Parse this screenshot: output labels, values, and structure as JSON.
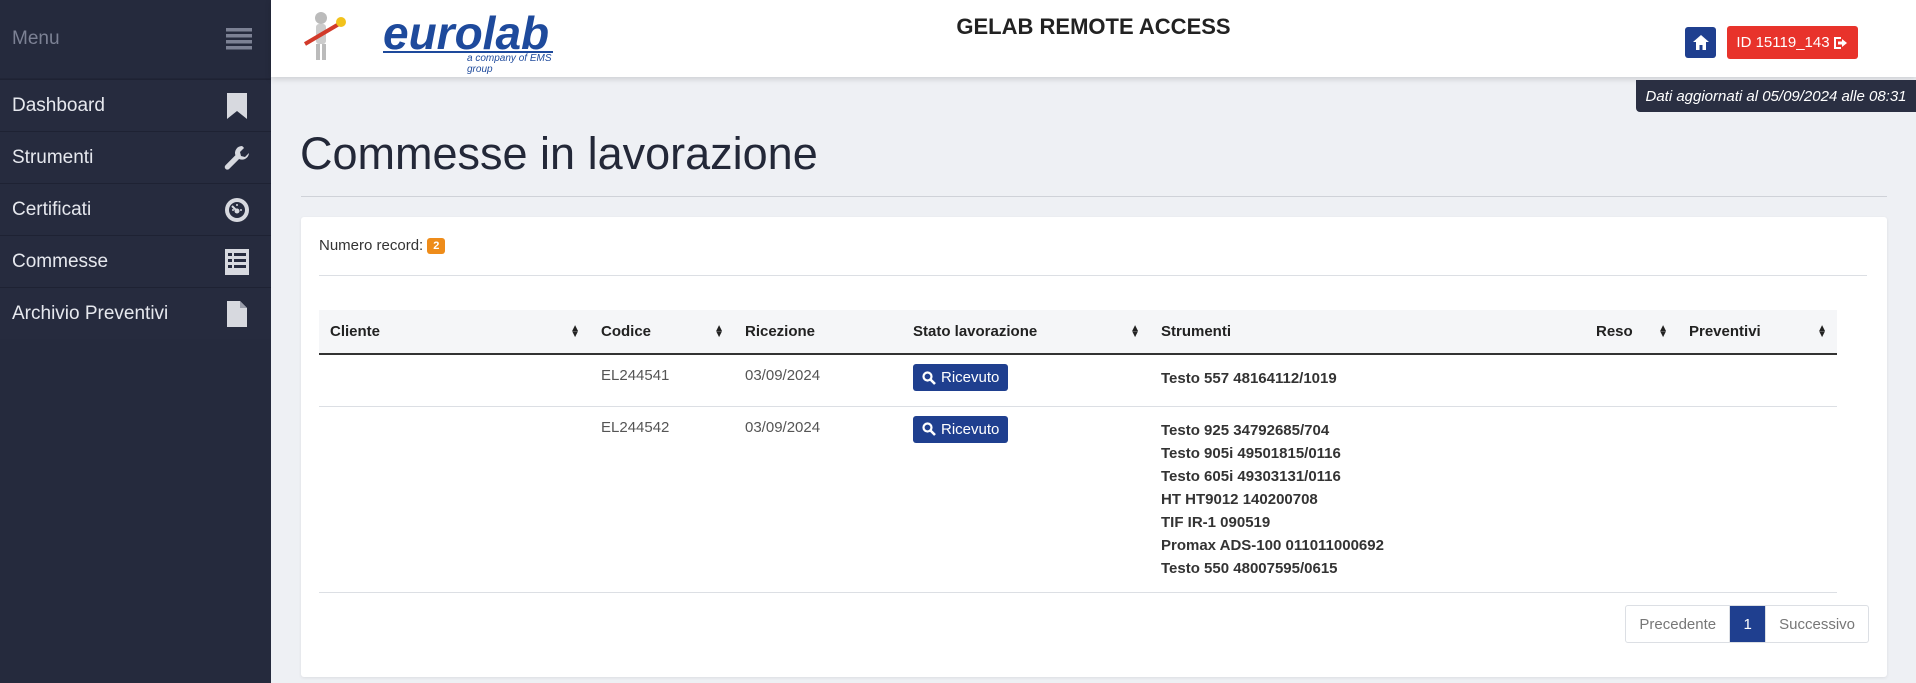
{
  "sidebar": {
    "menu_label": "Menu",
    "items": [
      {
        "label": "Dashboard",
        "icon": "bookmark-icon"
      },
      {
        "label": "Strumenti",
        "icon": "wrench-icon"
      },
      {
        "label": "Certificati",
        "icon": "dashboard-gauge-icon"
      },
      {
        "label": "Commesse",
        "icon": "list-icon"
      },
      {
        "label": "Archivio Preventivi",
        "icon": "file-icon"
      }
    ]
  },
  "header": {
    "logo_text": "eurolab",
    "logo_subtitle": "a company of EMS group",
    "app_title": "GELAB REMOTE ACCESS",
    "user_id": "ID 15119_143",
    "update_notice": "Dati aggiornati al 05/09/2024 alle 08:31"
  },
  "page": {
    "title": "Commesse in lavorazione",
    "records_label": "Numero record:",
    "records_count": "2"
  },
  "table": {
    "columns": [
      "Cliente",
      "Codice",
      "Ricezione",
      "Stato lavorazione",
      "Strumenti",
      "Reso",
      "Preventivi"
    ],
    "rows": [
      {
        "cliente": "",
        "codice": "EL244541",
        "ricezione": "03/09/2024",
        "stato": "Ricevuto",
        "strumenti": [
          "Testo 557 48164112/1019"
        ],
        "reso": "",
        "preventivi": ""
      },
      {
        "cliente": "",
        "codice": "EL244542",
        "ricezione": "03/09/2024",
        "stato": "Ricevuto",
        "strumenti": [
          "Testo 925 34792685/704",
          "Testo 905i 49501815/0116",
          "Testo 605i 49303131/0116",
          "HT HT9012 140200708",
          "TIF IR-1 090519",
          "Promax ADS-100 011011000692",
          "Testo 550 48007595/0615"
        ],
        "reso": "",
        "preventivi": ""
      }
    ]
  },
  "pagination": {
    "previous": "Precedente",
    "current": "1",
    "next": "Successivo"
  },
  "colors": {
    "sidebar_bg": "#252a3d",
    "primary": "#1f3f8f",
    "danger": "#e8332b",
    "badge": "#ee8c1a"
  }
}
